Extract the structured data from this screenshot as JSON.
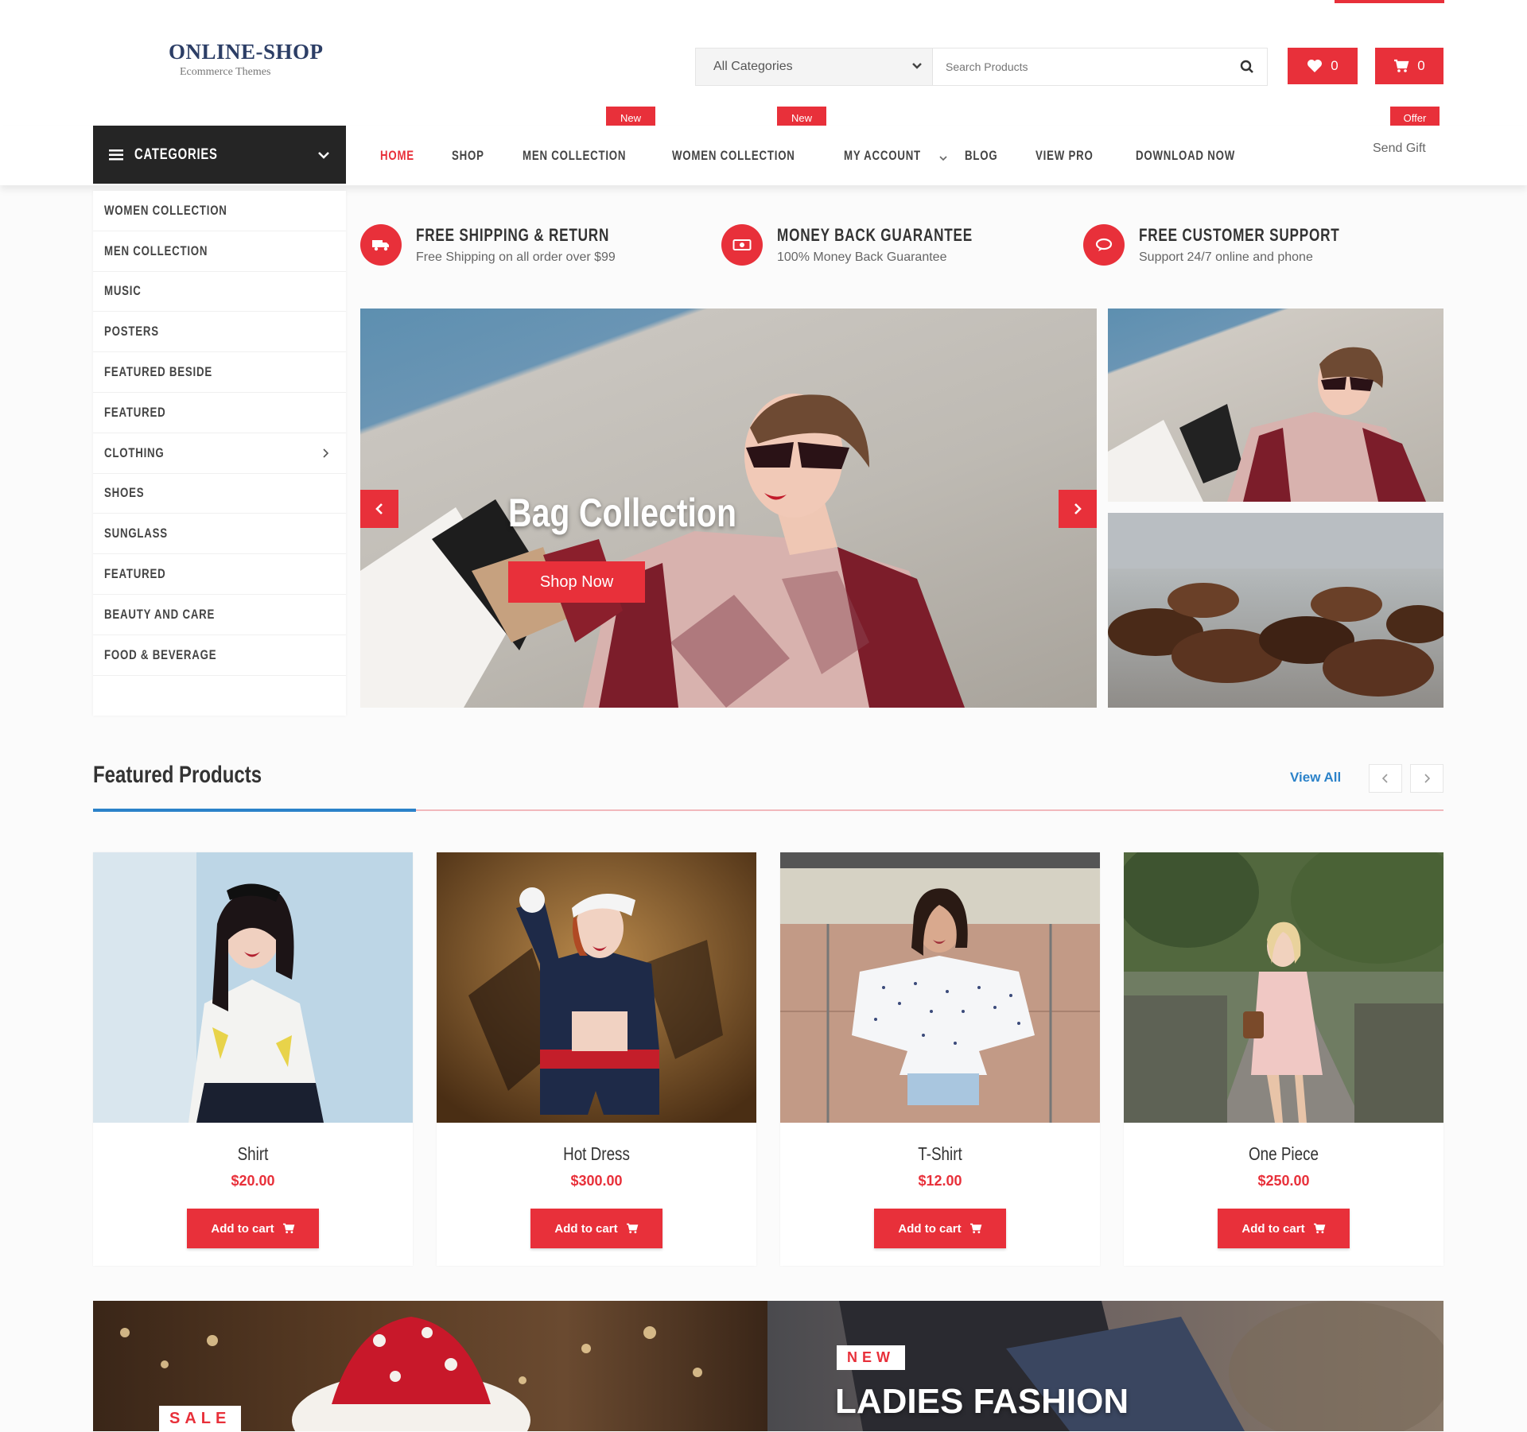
{
  "header": {
    "logo_title": "ONLINE-SHOP",
    "logo_subtitle": "Ecommerce Themes",
    "category_select": "All Categories",
    "search_placeholder": "Search Products",
    "wishlist_count": "0",
    "cart_count": "0"
  },
  "nav": {
    "categories_label": "CATEGORIES",
    "items": [
      {
        "label": "HOME"
      },
      {
        "label": "SHOP"
      },
      {
        "label": "MEN COLLECTION"
      },
      {
        "label": "WOMEN COLLECTION"
      },
      {
        "label": "MY ACCOUNT"
      },
      {
        "label": "BLOG"
      },
      {
        "label": "VIEW PRO"
      },
      {
        "label": "DOWNLOAD NOW"
      }
    ],
    "badges": [
      "New",
      "New",
      "Offer"
    ],
    "send_gift": "Send Gift"
  },
  "sidebar": {
    "items": [
      {
        "label": "WOMEN COLLECTION"
      },
      {
        "label": "MEN COLLECTION"
      },
      {
        "label": "MUSIC"
      },
      {
        "label": "POSTERS"
      },
      {
        "label": "FEATURED BESIDE"
      },
      {
        "label": "FEATURED"
      },
      {
        "label": "CLOTHING"
      },
      {
        "label": "SHOES"
      },
      {
        "label": "SUNGLASS"
      },
      {
        "label": "FEATURED"
      },
      {
        "label": "BEAUTY AND CARE"
      },
      {
        "label": "FOOD & BEVERAGE"
      }
    ]
  },
  "features": [
    {
      "title": "FREE SHIPPING & RETURN",
      "subtitle": "Free Shipping on all order over $99",
      "icon": "truck-icon"
    },
    {
      "title": "MONEY BACK GUARANTEE",
      "subtitle": "100% Money Back Guarantee",
      "icon": "money-icon"
    },
    {
      "title": "FREE CUSTOMER SUPPORT",
      "subtitle": "Support 24/7 online and phone",
      "icon": "chat-icon"
    }
  ],
  "hero": {
    "title": "Bag Collection",
    "button": "Shop Now"
  },
  "featured": {
    "title": "Featured Products",
    "view_all": "View All",
    "add_to_cart": "Add to cart",
    "products": [
      {
        "name": "Shirt",
        "price": "$20.00"
      },
      {
        "name": "Hot Dress",
        "price": "$300.00"
      },
      {
        "name": "T-Shirt",
        "price": "$12.00"
      },
      {
        "name": "One Piece",
        "price": "$250.00"
      }
    ]
  },
  "banners": {
    "sale_tag": "SALE",
    "new_tag": "NEW",
    "ladies_title": "LADIES FASHION"
  },
  "colors": {
    "accent": "#e8303a",
    "dark": "#252525",
    "link": "#2b82c9"
  }
}
